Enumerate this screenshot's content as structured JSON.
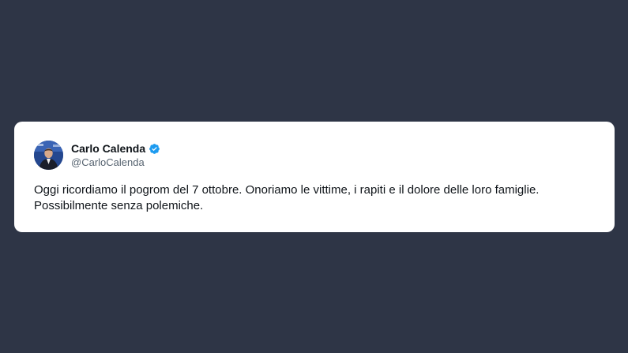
{
  "tweet": {
    "display_name": "Carlo Calenda",
    "handle": "@CarloCalenda",
    "verified": true,
    "text_line_1": "Oggi ricordiamo il pogrom del 7 ottobre. Onoriamo le vittime, i rapiti e il dolore delle loro famiglie.",
    "text_line_2": "Possibilmente senza polemiche.",
    "avatar_icon": "profile-photo",
    "verified_icon": "verified-badge-icon"
  },
  "colors": {
    "background": "#2e3546",
    "card": "#ffffff",
    "verified_blue": "#1d9bf0",
    "name_text": "#0f1419",
    "handle_text": "#566370"
  }
}
